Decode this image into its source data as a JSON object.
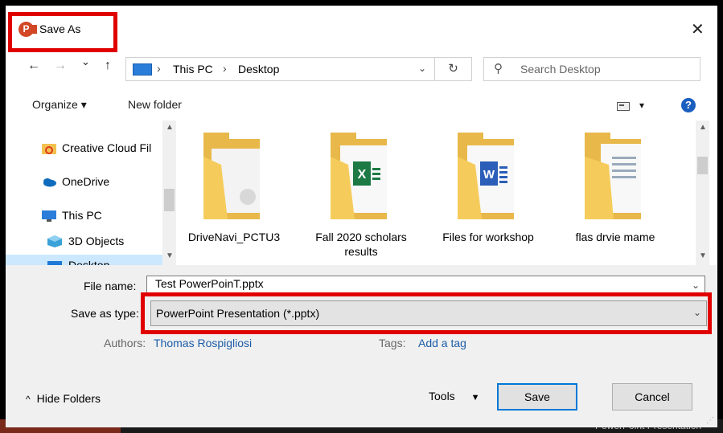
{
  "window": {
    "title": "Save As",
    "close_glyph": "✕"
  },
  "nav": {
    "back_glyph": "←",
    "forward_glyph": "→",
    "recent_glyph": "⌄",
    "up_glyph": "↑",
    "breadcrumb": [
      "This PC",
      "Desktop"
    ],
    "sep_glyph": "›",
    "refresh_glyph": "↻",
    "search_placeholder": "Search Desktop"
  },
  "toolbar": {
    "organize": "Organize ▾",
    "new_folder": "New folder",
    "view_dd": "▾",
    "help": "?"
  },
  "sidebar": {
    "items": [
      {
        "label": "Creative Cloud Fil",
        "icon": "creative-cloud-icon"
      },
      {
        "label": "OneDrive",
        "icon": "onedrive-icon"
      },
      {
        "label": "This PC",
        "icon": "this-pc-icon"
      },
      {
        "label": "3D Objects",
        "icon": "3d-objects-icon"
      },
      {
        "label": "Desktop",
        "icon": "desktop-icon"
      }
    ]
  },
  "files": [
    {
      "name": "DriveNavi_PCTU3",
      "type": "folder-generic"
    },
    {
      "name": "Fall 2020 scholars results",
      "type": "folder-excel"
    },
    {
      "name": "Files for workshop",
      "type": "folder-word"
    },
    {
      "name": "flas drvie mame",
      "type": "folder-docs"
    }
  ],
  "form": {
    "file_name_label": "File name:",
    "file_name_value": "Test PowerPoinT.pptx",
    "save_type_label": "Save as type:",
    "save_type_value": "PowerPoint Presentation (*.pptx)",
    "authors_label": "Authors:",
    "authors_value": "Thomas Rospigliosi",
    "tags_label": "Tags:",
    "tags_value": "Add a tag"
  },
  "footer": {
    "hide_folders": "Hide Folders",
    "tools": "Tools",
    "save": "Save",
    "cancel": "Cancel"
  },
  "colors": {
    "highlight": "#e00000",
    "accent": "#0078d7",
    "link": "#1b5ca8"
  },
  "background_text": "PowerPoint Presentation"
}
